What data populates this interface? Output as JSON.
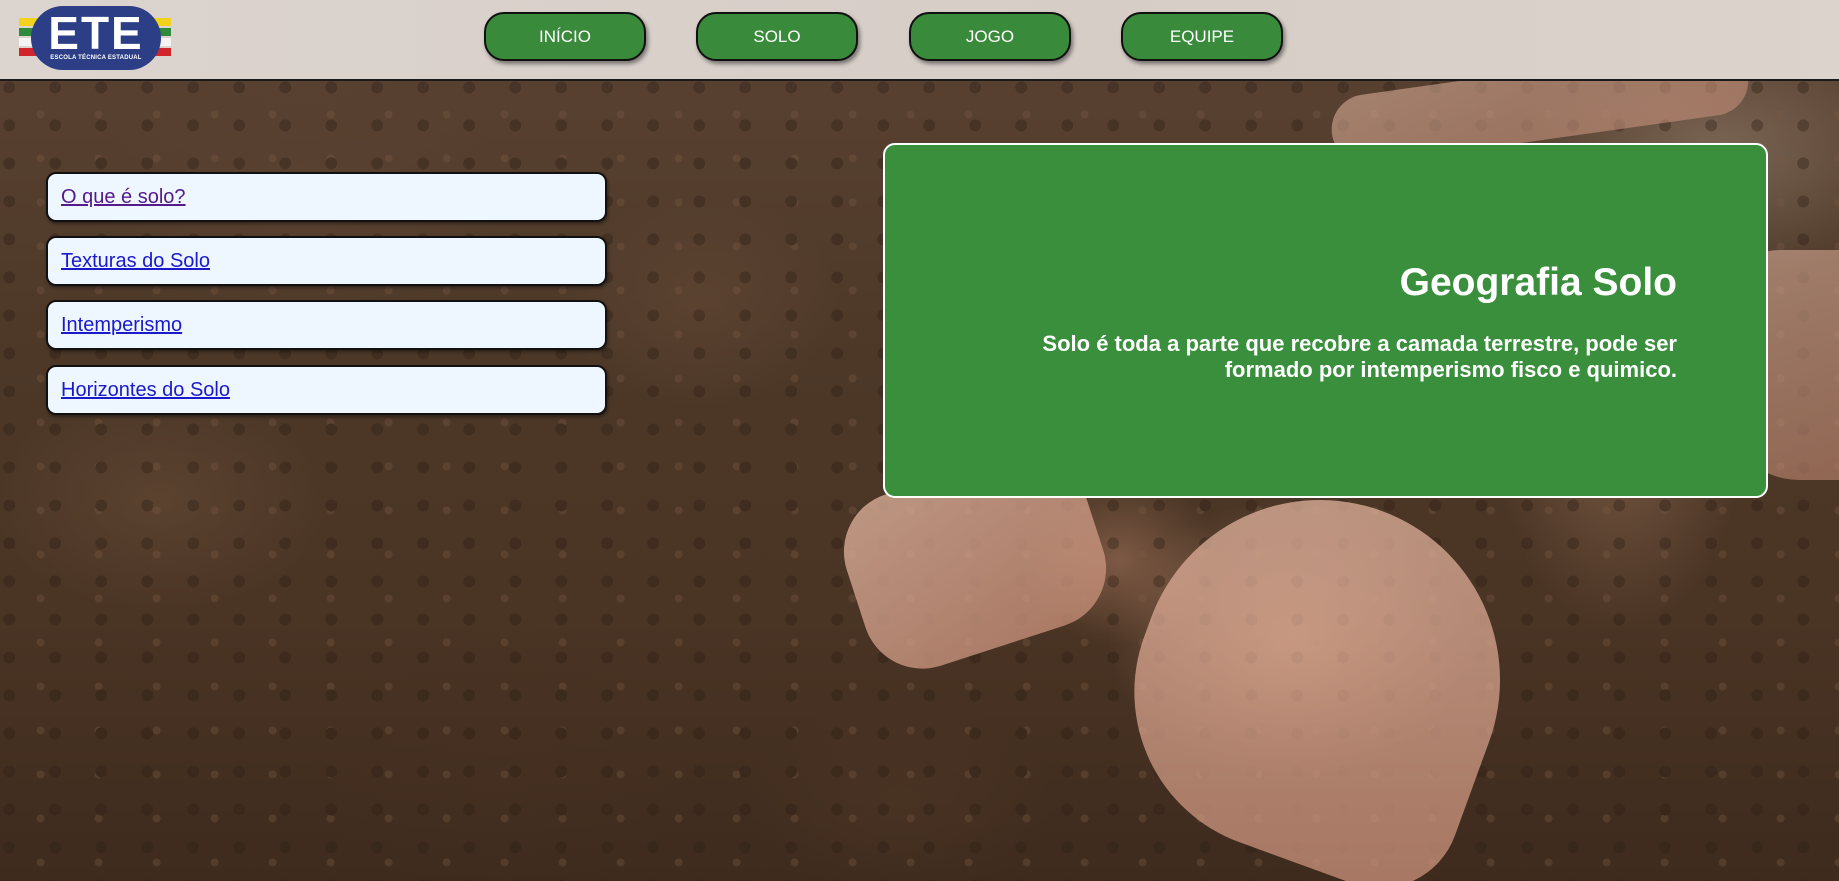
{
  "logo": {
    "title": "ETE",
    "subtitle": "ESCOLA TÉCNICA ESTADUAL"
  },
  "nav": {
    "items": [
      {
        "label": "INÍCIO"
      },
      {
        "label": "SOLO"
      },
      {
        "label": "JOGO"
      },
      {
        "label": "EQUIPE"
      }
    ]
  },
  "sidebar": {
    "links": [
      {
        "label": "O que é solo?",
        "visited": true
      },
      {
        "label": "Texturas do Solo",
        "visited": false
      },
      {
        "label": "Intemperismo",
        "visited": false
      },
      {
        "label": "Horizontes do Solo",
        "visited": false
      }
    ]
  },
  "card": {
    "title": "Geografia Solo",
    "text": "Solo é toda a parte que recobre a camada terrestre, pode ser formado por intemperismo fisco e quimico."
  },
  "colors": {
    "accent_green": "#3a8f3d",
    "nav_green": "#3a8a3c",
    "link_blue": "#1a1acc",
    "link_visited": "#551a8b",
    "menu_bg": "#eef6ff",
    "header_bg": "#d9cfc9"
  },
  "background": {
    "image": "soil-hands-photo"
  }
}
